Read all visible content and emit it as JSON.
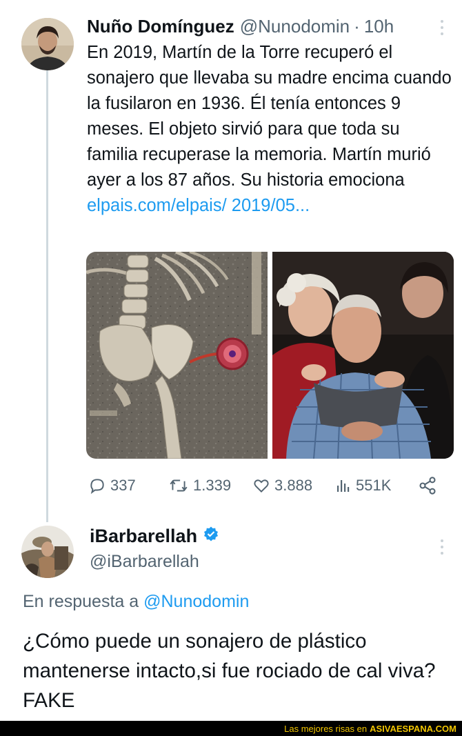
{
  "tweet": {
    "author_name": "Nuño Domínguez",
    "author_handle": "@Nunodomin",
    "separator": "·",
    "time": "10h",
    "text": "En 2019, Martín de la Torre recuperó el sonajero que llevaba su madre encima cuando la fusilaron en 1936. Él tenía entonces 9 meses. El objeto sirvió para que toda su familia recuperase la memoria. Martín murió ayer a los 87 años. Su historia emociona",
    "link_text": "elpais.com/elpais/ 2019/05...",
    "media": [
      {
        "name": "skeleton-photo"
      },
      {
        "name": "family-photo"
      }
    ],
    "stats": {
      "replies": "337",
      "retweets": "1.339",
      "likes": "3.888",
      "views": "551K"
    }
  },
  "reply": {
    "author_name": "iBarbarellah",
    "author_handle": "@iBarbarellah",
    "verified": true,
    "reply_prefix": "En respuesta a",
    "reply_mention": "@Nunodomin",
    "text": "¿Cómo puede un sonajero de plástico mantenerse intacto,si fue rociado de cal viva? FAKE"
  },
  "footer": {
    "text": "Las mejores risas en",
    "brand": "ASIVAESPANA.COM"
  },
  "colors": {
    "link": "#1d9bf0",
    "muted": "#536471",
    "text": "#0f1419",
    "footer_bg": "#000000",
    "footer_text": "#f2c500"
  },
  "icons": [
    "reply-icon",
    "retweet-icon",
    "like-icon",
    "views-icon",
    "share-icon",
    "verified-badge-icon",
    "more-icon"
  ]
}
